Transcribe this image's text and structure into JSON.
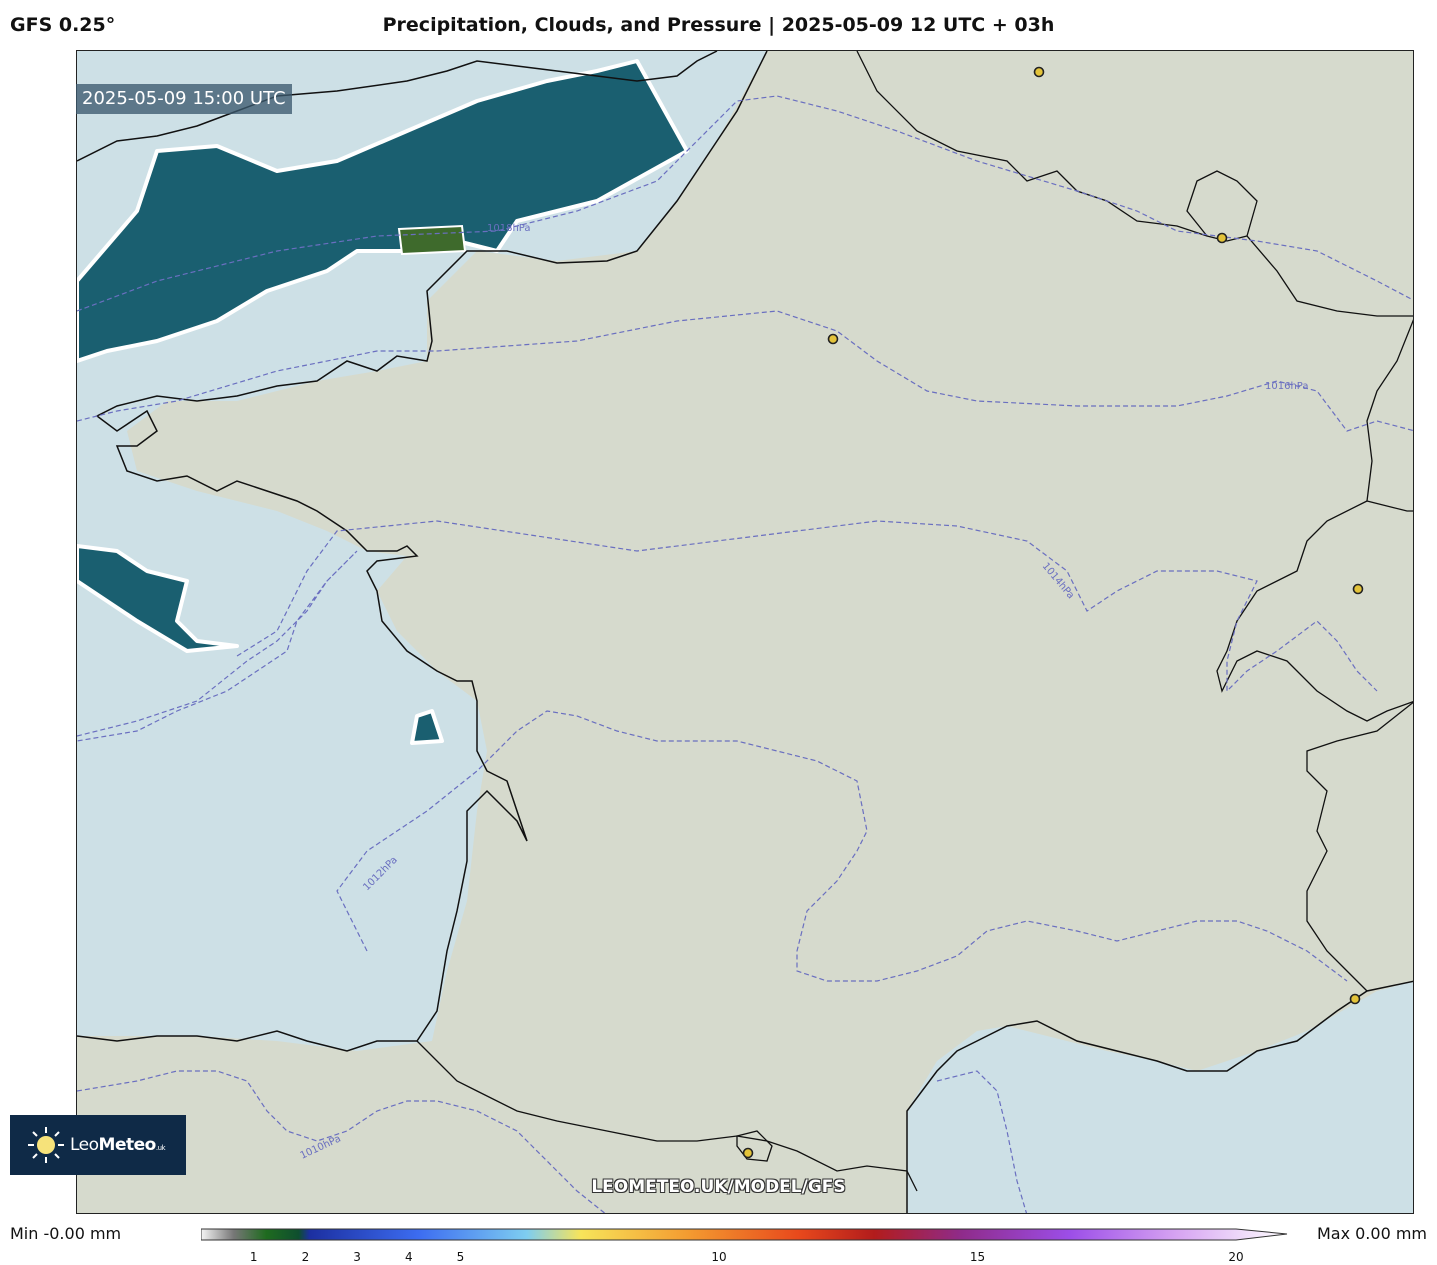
{
  "header": {
    "model": "GFS 0.25°",
    "title": "Precipitation, Clouds, and Pressure | 2025-05-09 12 UTC + 03h"
  },
  "map": {
    "valid_time": "2025-05-09 15:00 UTC",
    "isobar_labels": [
      "1018hPa",
      "1016hPa",
      "1014hPa",
      "1012hPa",
      "1010hPa"
    ],
    "colors": {
      "land": "#d8dcd0",
      "sea": "#cde0e6",
      "precip": "#1a5f70",
      "isobar": "#6a6fc0",
      "city": "#e3c33a"
    }
  },
  "logo": {
    "brand_light": "Leo",
    "brand_bold": "Meteo",
    "brand_suffix": ".uk"
  },
  "watermark": "LEOMETEO.UK/MODEL/GFS",
  "legend": {
    "min_label": "Min -0.00 mm",
    "max_label": "Max 0.00 mm",
    "ticks": [
      "1",
      "2",
      "3",
      "4",
      "5",
      "10",
      "15",
      "20"
    ],
    "tick_values": [
      1,
      2,
      3,
      4,
      5,
      10,
      15,
      20
    ],
    "range": [
      0,
      20
    ]
  }
}
